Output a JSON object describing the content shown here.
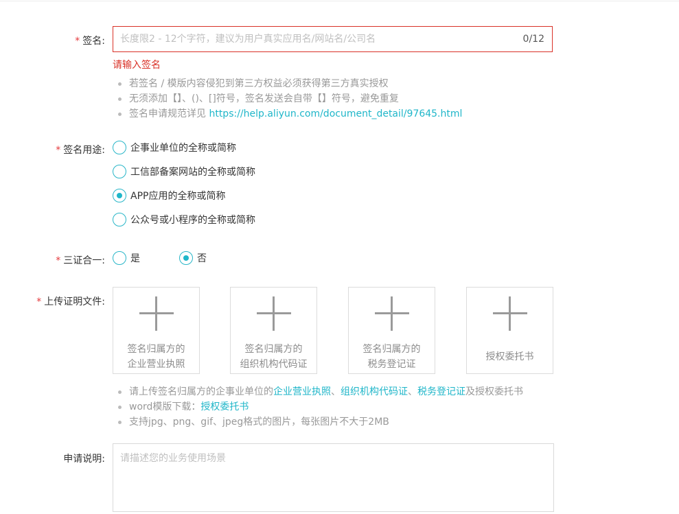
{
  "signature": {
    "label": "签名:",
    "required_mark": "*",
    "placeholder": "长度限2 - 12个字符，建议为用户真实应用名/网站名/公司名",
    "value": "",
    "counter": "0/12",
    "error": "请输入签名",
    "tips": [
      {
        "text": "若签名 / 模版内容侵犯到第三方权益必须获得第三方真实授权"
      },
      {
        "text": "无须添加【】、()、[]符号，签名发送会自带【】符号，避免重复"
      },
      {
        "prefix": "签名申请规范详见 ",
        "link": "https://help.aliyun.com/document_detail/97645.html"
      }
    ]
  },
  "purpose": {
    "label": "签名用途:",
    "required_mark": "*",
    "options": [
      {
        "label": "企事业单位的全称或简称",
        "selected": false
      },
      {
        "label": "工信部备案网站的全称或简称",
        "selected": false
      },
      {
        "label": "APP应用的全称或简称",
        "selected": true
      },
      {
        "label": "公众号或小程序的全称或简称",
        "selected": false
      }
    ]
  },
  "three_in_one": {
    "label": "三证合一:",
    "required_mark": "*",
    "options": [
      {
        "label": "是",
        "selected": false
      },
      {
        "label": "否",
        "selected": true
      }
    ]
  },
  "upload": {
    "label": "上传证明文件:",
    "required_mark": "*",
    "boxes": [
      {
        "line1": "签名归属方的",
        "line2": "企业营业执照"
      },
      {
        "line1": "签名归属方的",
        "line2": "组织机构代码证"
      },
      {
        "line1": "签名归属方的",
        "line2": "税务登记证"
      },
      {
        "line1": "授权委托书",
        "line2": ""
      }
    ],
    "tips": {
      "t1_prefix": "请上传签名归属方的企事业单位的",
      "t1_link1": "企业营业执照",
      "t1_sep1": "、",
      "t1_link2": "组织机构代码证",
      "t1_sep2": "、",
      "t1_link3": "税务登记证",
      "t1_suffix": "及授权委托书",
      "t2_prefix": "word模版下载：",
      "t2_link": "授权委托书",
      "t3": "支持jpg、png、gif、jpeg格式的图片，每张图片不大于2MB"
    }
  },
  "description": {
    "label": "申请说明:",
    "placeholder": "请描述您的业务使用场景",
    "value": ""
  },
  "colors": {
    "accent": "#1fb6c9",
    "error": "#d93026",
    "required": "#e4393c"
  }
}
